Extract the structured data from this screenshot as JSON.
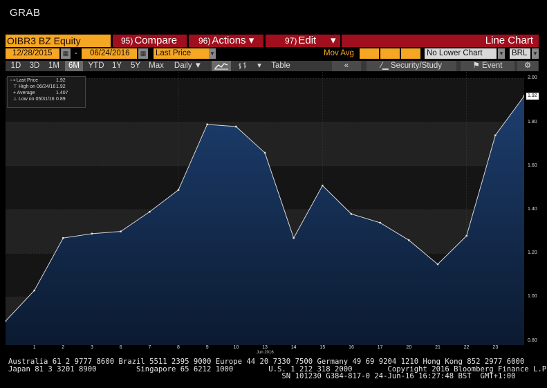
{
  "window_title": "GRAB",
  "toolbar": {
    "ticker": "OIBR3 BZ Equity",
    "compare": {
      "num": "95)",
      "label": "Compare"
    },
    "actions": {
      "num": "96)",
      "label": "Actions",
      "arrow": "▾"
    },
    "edit": {
      "num": "97)",
      "label": "Edit",
      "arrow": "▾"
    },
    "chart_type": "Line Chart"
  },
  "range": {
    "start_date": "12/28/2015",
    "sep": "-",
    "end_date": "06/24/2016",
    "field": "Last Price",
    "mov_avg_label": "Mov Avg",
    "lower_chart": "No Lower Chart",
    "currency": "BRL"
  },
  "periods": [
    "1D",
    "3D",
    "1M",
    "6M",
    "YTD",
    "1Y",
    "5Y",
    "Max"
  ],
  "active_period": "6M",
  "frequency": "Daily",
  "view_buttons": {
    "table": "Table",
    "back": "«",
    "security": "Security/Study",
    "event": "Event",
    "settings": "⚙"
  },
  "legend": {
    "rows": [
      {
        "label": "Last Price",
        "value": "1.92"
      },
      {
        "label": "High on 06/24/16",
        "value": "1.92"
      },
      {
        "label": "Average",
        "value": "1.407"
      },
      {
        "label": "Low on 05/31/16",
        "value": "0.89"
      }
    ]
  },
  "colors": {
    "series": "#d8d8d8",
    "fill_top": "#1c3a66",
    "fill_bottom": "#0e1d35",
    "accent": "#f5a623",
    "button_red": "#a00f1d"
  },
  "chart_data": {
    "type": "area",
    "series": [
      {
        "name": "Last Price",
        "x": [
          "May 31",
          "1",
          "2",
          "3",
          "6",
          "7",
          "8",
          "9",
          "10",
          "13",
          "14",
          "15",
          "16",
          "17",
          "20",
          "21",
          "22",
          "23",
          "24"
        ],
        "values": [
          0.89,
          1.03,
          1.27,
          1.29,
          1.3,
          1.39,
          1.49,
          1.79,
          1.78,
          1.66,
          1.27,
          1.51,
          1.38,
          1.34,
          1.26,
          1.15,
          1.28,
          1.74,
          1.92
        ]
      }
    ],
    "x_ticks": [
      "1",
      "2",
      "3",
      "6",
      "7",
      "8",
      "9",
      "10",
      "13",
      "14",
      "15",
      "16",
      "17",
      "20",
      "21",
      "22",
      "23"
    ],
    "x_month_label": "Jun 2016",
    "y_ticks": [
      "2.00",
      "1.80",
      "1.60",
      "1.40",
      "1.20",
      "1.00",
      "0.80"
    ],
    "ylim": [
      0.78,
      2.03
    ],
    "last_value_tag": "1.92",
    "grid": true,
    "legend_position": "top-left"
  },
  "footer": {
    "line1": "Australia 61 2 9777 8600 Brazil 5511 2395 9000 Europe 44 20 7330 7500 Germany 49 69 9204 1210 Hong Kong 852 2977 6000",
    "line2": "Japan 81 3 3201 8900         Singapore 65 6212 1000        U.S. 1 212 318 2000        Copyright 2016 Bloomberg Finance L.P.",
    "line3": "                                                              SN 101230 G384-817-0 24-Jun-16 16:27:48 BST  GMT+1:00"
  }
}
